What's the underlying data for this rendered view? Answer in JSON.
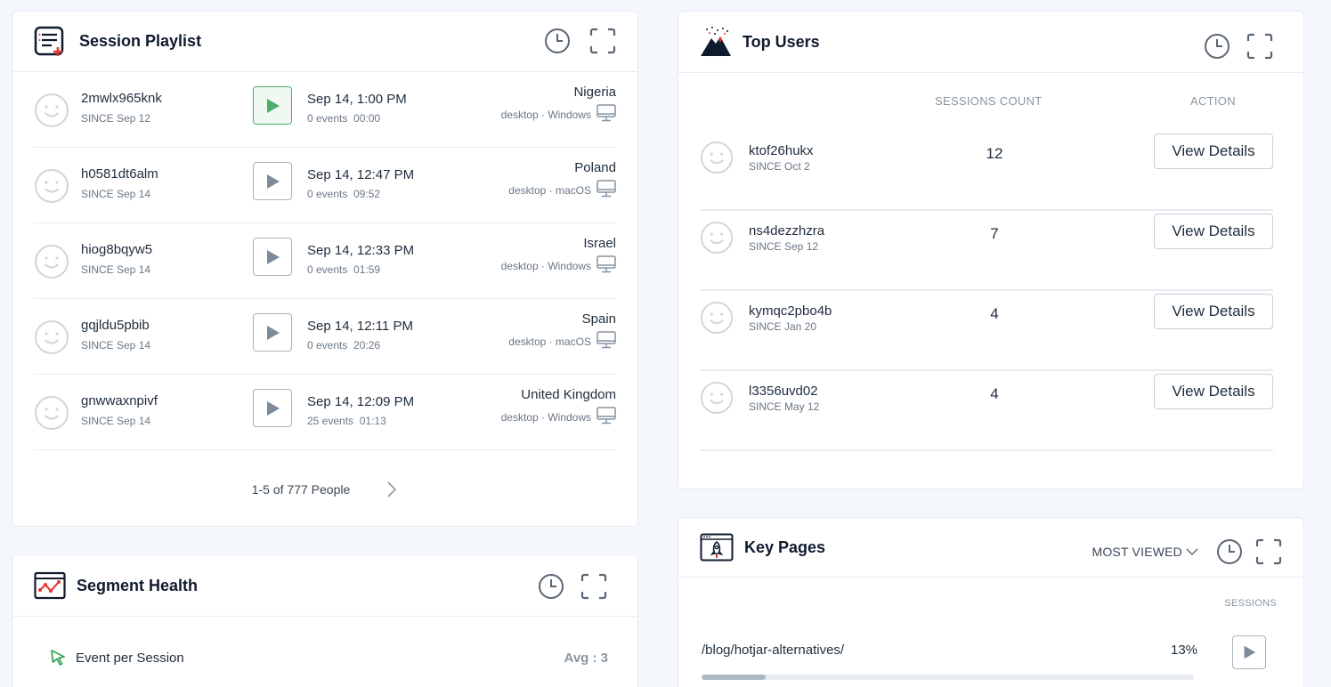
{
  "playlist": {
    "title": "Session Playlist",
    "icon": "playlist-icon",
    "sessions": [
      {
        "user": "2mwlx965knk",
        "since": "SINCE Sep 12",
        "date": "Sep 14, 1:00 PM",
        "events": "0 events",
        "duration": "00:00",
        "country": "Nigeria",
        "device": "desktop",
        "os": "Windows",
        "active": true
      },
      {
        "user": "h0581dt6alm",
        "since": "SINCE Sep 14",
        "date": "Sep 14, 12:47 PM",
        "events": "0 events",
        "duration": "09:52",
        "country": "Poland",
        "device": "desktop",
        "os": "macOS",
        "active": false
      },
      {
        "user": "hiog8bqyw5",
        "since": "SINCE Sep 14",
        "date": "Sep 14, 12:33 PM",
        "events": "0 events",
        "duration": "01:59",
        "country": "Israel",
        "device": "desktop",
        "os": "Windows",
        "active": false
      },
      {
        "user": "gqjldu5pbib",
        "since": "SINCE Sep 14",
        "date": "Sep 14, 12:11 PM",
        "events": "0 events",
        "duration": "20:26",
        "country": "Spain",
        "device": "desktop",
        "os": "macOS",
        "active": false
      },
      {
        "user": "gnwwaxnpivf",
        "since": "SINCE Sep 14",
        "date": "Sep 14, 12:09 PM",
        "events": "25 events",
        "duration": "01:13",
        "country": "United Kingdom",
        "device": "desktop",
        "os": "Windows",
        "active": false
      }
    ],
    "pagination": "1-5 of 777 People"
  },
  "top_users": {
    "title": "Top Users",
    "col_count": "SESSIONS COUNT",
    "col_action": "ACTION",
    "users": [
      {
        "user": "ktof26hukx",
        "since": "SINCE Oct 2",
        "count": "12",
        "action": "View Details"
      },
      {
        "user": "ns4dezzhzra",
        "since": "SINCE Sep 12",
        "count": "7",
        "action": "View Details"
      },
      {
        "user": "kymqc2pbo4b",
        "since": "SINCE Jan 20",
        "count": "4",
        "action": "View Details"
      },
      {
        "user": "l3356uvd02",
        "since": "SINCE May 12",
        "count": "4",
        "action": "View Details"
      }
    ]
  },
  "segment_health": {
    "title": "Segment Health",
    "metric_label": "Event per Session",
    "metric_value": "Avg : 3"
  },
  "key_pages": {
    "title": "Key Pages",
    "sort_label": "MOST VIEWED",
    "col_sessions": "SESSIONS",
    "pages": [
      {
        "path": "/blog/hotjar-alternatives/",
        "percent": "13%",
        "fraction": 0.13
      }
    ]
  },
  "colors": {
    "accent_green": "#4caf6c",
    "accent_red": "#e53935",
    "muted": "#8a96a3"
  }
}
